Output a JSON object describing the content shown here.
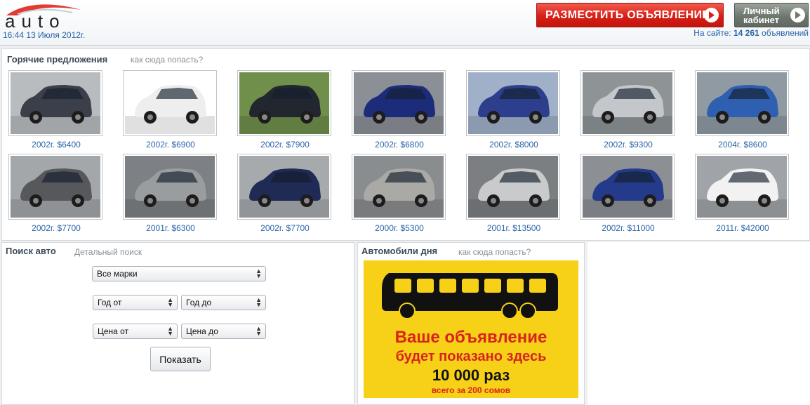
{
  "header": {
    "logo_text": "auto",
    "datetime": "16:44 13 Июля 2012г.",
    "post_ad_label": "РАЗМЕСТИТЬ ОБЪЯВЛЕНИЕ",
    "cabinet_line1": "Личный",
    "cabinet_line2": "кабинет",
    "site_count_prefix": "На сайте:",
    "site_count_value": "14 261",
    "site_count_suffix": "объявлений"
  },
  "hot": {
    "title": "Горячие предложения",
    "subtitle": "как сюда попасть?",
    "cars": [
      {
        "price": "2002г. $6400",
        "color": "#3b3f49",
        "bg": "#b9bcbf"
      },
      {
        "price": "2002г. $6900",
        "color": "#eeeeee",
        "bg": "#ffffff"
      },
      {
        "price": "2002г. $7900",
        "color": "#22262e",
        "bg": "#6f8f4a"
      },
      {
        "price": "2002г. $6800",
        "color": "#1d2c7a",
        "bg": "#8b8f96"
      },
      {
        "price": "2002г. $8000",
        "color": "#2d3f8c",
        "bg": "#9fb0c8"
      },
      {
        "price": "2002г. $9300",
        "color": "#c3c6ca",
        "bg": "#8e9396"
      },
      {
        "price": "2004г. $8600",
        "color": "#2f5fb0",
        "bg": "#8f9aa3"
      },
      {
        "price": "2002г. $7700",
        "color": "#56585c",
        "bg": "#a3a7aa"
      },
      {
        "price": "2001г. $6300",
        "color": "#9a9d9f",
        "bg": "#7d8185"
      },
      {
        "price": "2002г. $7700",
        "color": "#1f2a55",
        "bg": "#a6aaad"
      },
      {
        "price": "2000г. $5300",
        "color": "#a9aaa6",
        "bg": "#8a8d8f"
      },
      {
        "price": "2001г. $13500",
        "color": "#c8cacc",
        "bg": "#7b7f82"
      },
      {
        "price": "2002г. $11000",
        "color": "#243a8a",
        "bg": "#8c9094"
      },
      {
        "price": "2011г. $42000",
        "color": "#f2f2f2",
        "bg": "#a0a4a8"
      }
    ]
  },
  "search": {
    "title": "Поиск авто",
    "subtitle": "Детальный поиск",
    "make_select": "Все марки",
    "year_from": "Год от",
    "year_to": "Год до",
    "price_from": "Цена от",
    "price_to": "Цена до",
    "show_button": "Показать"
  },
  "daycars": {
    "title": "Автомобили дня",
    "subtitle": "как сюда попасть?",
    "banner_line1": "Ваше объявление",
    "banner_line2": "будет показано здесь",
    "banner_line3": "10 000 раз",
    "banner_line4": "всего за 200 сомов"
  },
  "colors": {
    "link": "#2a64a8",
    "post_ad": "#d71f16",
    "cabinet": "#6f786f",
    "banner_bg": "#f7d117",
    "banner_text": "#d8241c"
  }
}
